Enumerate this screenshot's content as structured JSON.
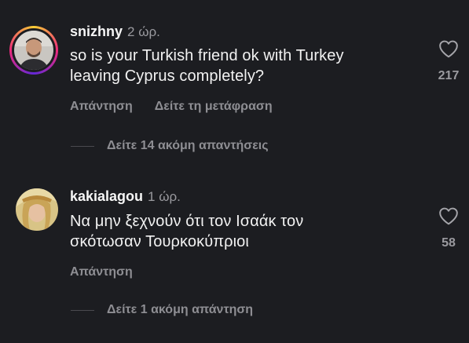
{
  "comments": [
    {
      "username": "snizhny",
      "time": "2 ώρ.",
      "text_line1": "so is your Turkish friend ok with Turkey",
      "text_line2": "leaving Cyprus completely?",
      "reply_label": "Απάντηση",
      "translate_label": "Δείτε τη μετάφραση",
      "likes": "217",
      "more_replies": "Δείτε 14 ακόμη απαντήσεις"
    },
    {
      "username": "kakialagou",
      "time": "1 ώρ.",
      "text_line1": "Να μην ξεχνούν ότι τον Ισαάκ τον",
      "text_line2": "σκότωσαν Τουρκοκύπριοι",
      "reply_label": "Απάντηση",
      "likes": "58",
      "more_replies": "Δείτε 1 ακόμη απάντηση"
    }
  ],
  "icons": {
    "like": "heart-outline-icon"
  },
  "colors": {
    "background": "#1c1d21",
    "primary_text": "#f2f2f2",
    "secondary_text": "#8e8e93",
    "story_ring": "#ee2a7b"
  }
}
